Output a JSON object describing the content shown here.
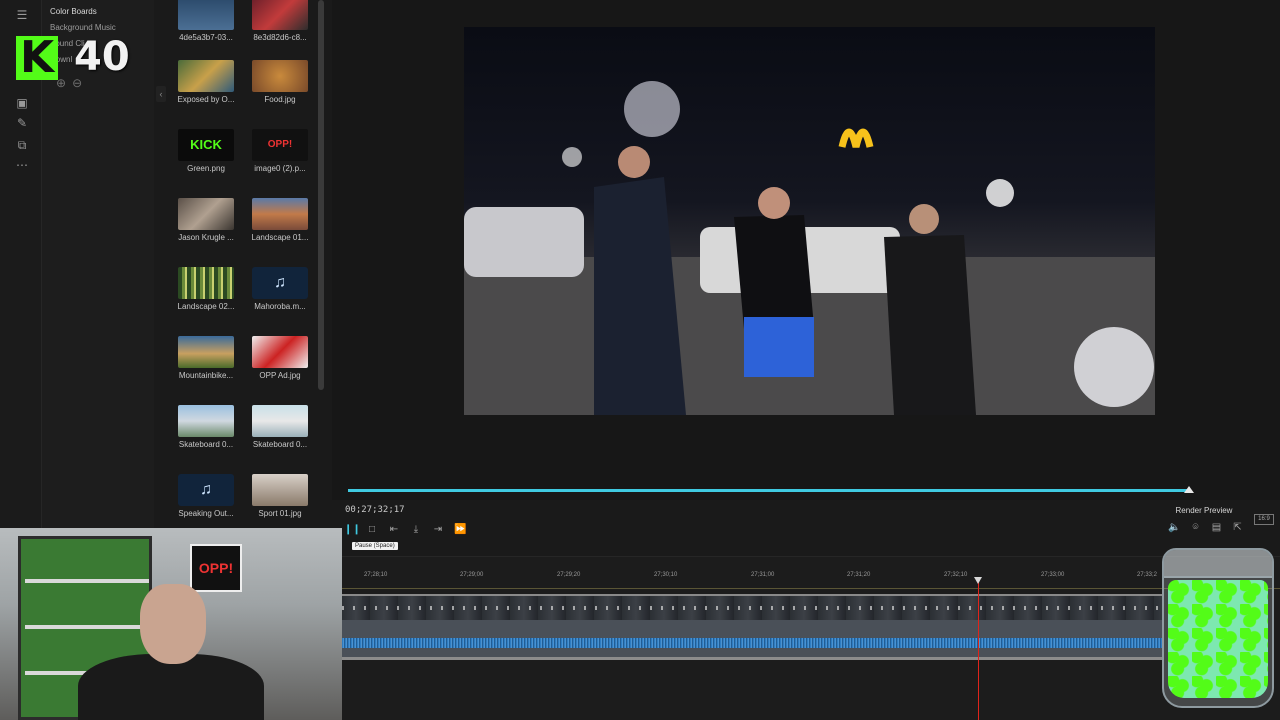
{
  "overlay": {
    "kick_count": "40",
    "kick_letter": "K"
  },
  "sidebar": {
    "categories": [
      "Color Boards",
      "Background Music",
      "Sound Cli",
      "Downl"
    ]
  },
  "media": {
    "items": [
      {
        "name": "4de5a3b7-03...",
        "kind": "image"
      },
      {
        "name": "8e3d82d6-c8...",
        "kind": "image"
      },
      {
        "name": "Exposed by O...",
        "kind": "video"
      },
      {
        "name": "Food.jpg",
        "kind": "image"
      },
      {
        "name": "Green.png",
        "kind": "image",
        "thumb_text": "KICK"
      },
      {
        "name": "image0 (2).p...",
        "kind": "image",
        "thumb_text": "OPP!"
      },
      {
        "name": "Jason Krugle ...",
        "kind": "image"
      },
      {
        "name": "Landscape 01...",
        "kind": "image"
      },
      {
        "name": "Landscape 02...",
        "kind": "image"
      },
      {
        "name": "Mahoroba.m...",
        "kind": "audio"
      },
      {
        "name": "Mountainbike...",
        "kind": "video"
      },
      {
        "name": "OPP Ad.jpg",
        "kind": "image"
      },
      {
        "name": "Skateboard 0...",
        "kind": "video"
      },
      {
        "name": "Skateboard 0...",
        "kind": "video"
      },
      {
        "name": "Speaking Out...",
        "kind": "audio"
      },
      {
        "name": "Sport 01.jpg",
        "kind": "image"
      }
    ]
  },
  "player": {
    "timecode": "00;27;32;17",
    "render_preview": "Render Preview",
    "aspect_ratio": "16:9",
    "tooltip": "Pause (Space)",
    "scrub_progress": 0.993
  },
  "timeline": {
    "ruler": [
      "27;28;10",
      "27;29;00",
      "27;29;20",
      "27;30;10",
      "27;31;00",
      "27;31;20",
      "27;32;10",
      "27;33;00",
      "27;33;2"
    ]
  },
  "webcam": {
    "poster_text": "OPP!"
  },
  "colors": {
    "accent": "#3fc9e0",
    "playhead": "#e0241b",
    "kick_green": "#53fc18"
  }
}
